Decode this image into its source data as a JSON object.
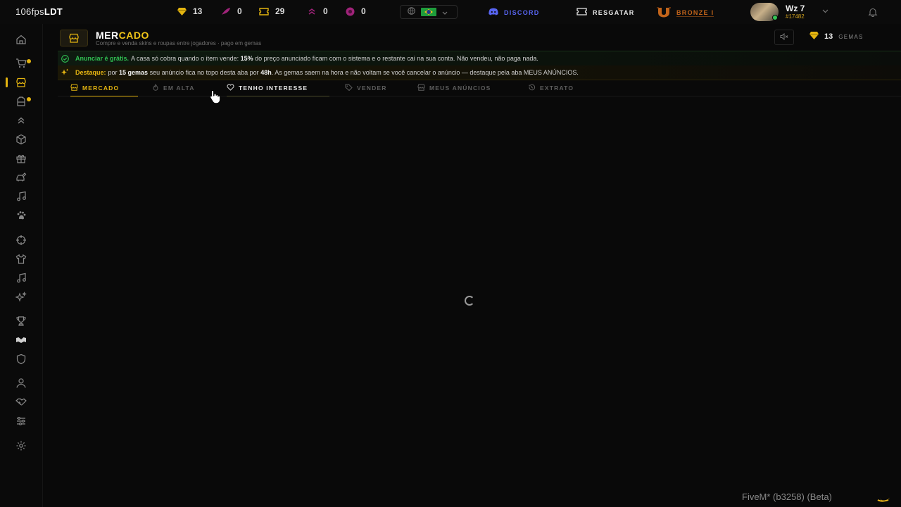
{
  "topbar": {
    "fps_value": "106fps",
    "fps_brand": "LDT",
    "stats": [
      {
        "icon": "gem-icon",
        "value": "13",
        "color": "#e3b410"
      },
      {
        "icon": "feather-icon",
        "value": "0",
        "color": "#a0237a"
      },
      {
        "icon": "ticket-icon",
        "value": "29",
        "color": "#e3b410"
      },
      {
        "icon": "rank-chevrons-icon",
        "value": "0",
        "color": "#a0237a"
      },
      {
        "icon": "coin-icon",
        "value": "0",
        "color": "#a0237a"
      }
    ],
    "discord_label": "DISCORD",
    "resgatar_label": "RESGATAR",
    "rank_label": "BRONZE I",
    "user": {
      "name": "Wz 7",
      "id": "#17482"
    }
  },
  "header": {
    "title_part1": "MER",
    "title_part2": "CADO",
    "subtitle": "Compre e venda skins e roupas entre jogadores · pago em gemas",
    "gems_value": "13",
    "gems_label": "GEMAS"
  },
  "banners": {
    "free": {
      "highlight": "Anunciar é grátis.",
      "text1": "A casa só cobra quando o item vende: ",
      "strong1": "15%",
      "text2": " do preço anunciado ficam com o sistema e o restante cai na sua conta. Não vendeu, não paga nada."
    },
    "destaque": {
      "highlight": "Destaque:",
      "text1": "por ",
      "strong1": "15 gemas",
      "text2": " seu anúncio fica no topo desta aba por ",
      "strong2": "48h",
      "text3": ". As gemas saem na hora e não voltam se você cancelar o anúncio — destaque pela aba MEUS ANÚNCIOS."
    }
  },
  "tabs": [
    {
      "label": "MERCADO",
      "icon": "store-icon"
    },
    {
      "label": "EM ALTA",
      "icon": "flame-icon"
    },
    {
      "label": "TENHO INTERESSE",
      "icon": "heart-icon"
    },
    {
      "label": "VENDER",
      "icon": "tag-icon"
    },
    {
      "label": "MEUS ANÚNCIOS",
      "icon": "list-icon"
    },
    {
      "label": "EXTRATO",
      "icon": "history-icon"
    }
  ],
  "footer": {
    "watermark": "FiveM* (b3258) (Beta)"
  },
  "colors": {
    "accent": "#e3b410",
    "green": "#30c052",
    "discord": "#5865f2",
    "bronze": "#c2641a"
  }
}
